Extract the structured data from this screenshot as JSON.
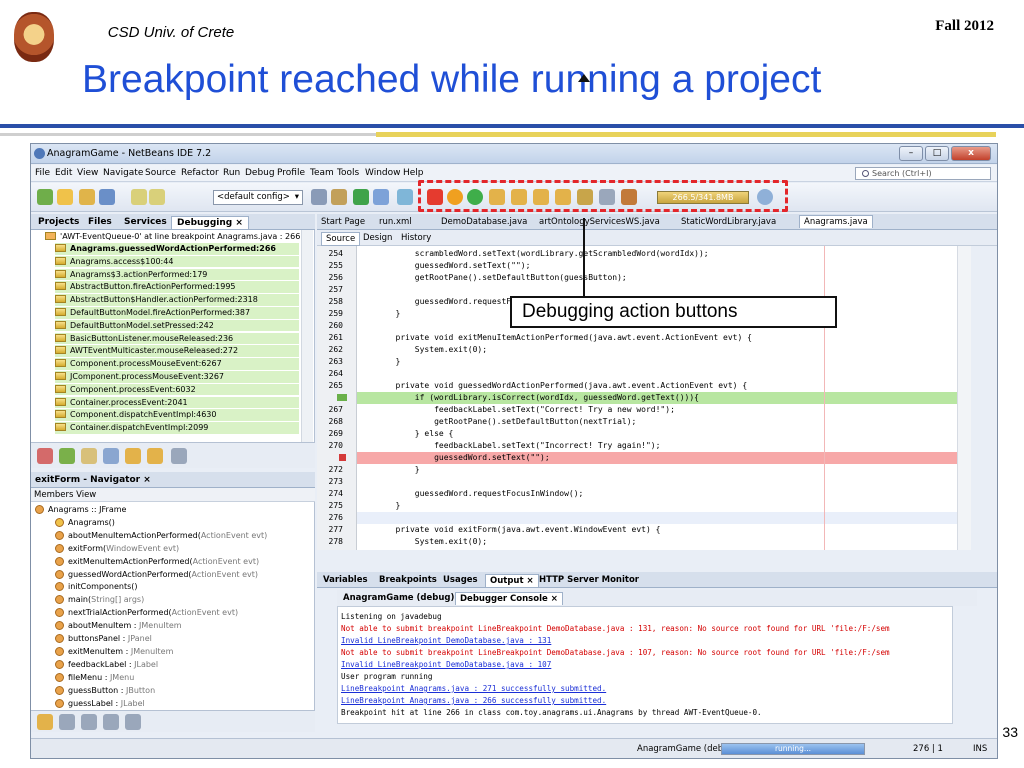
{
  "slide": {
    "course": "CSD Univ. of Crete",
    "semester": "Fall 2012",
    "title": "Breakpoint reached while running a project",
    "page_number": "33",
    "callout": "Debugging action buttons"
  },
  "ide": {
    "window_title": "AnagramGame - NetBeans IDE 7.2",
    "menu": [
      "File",
      "Edit",
      "View",
      "Navigate",
      "Source",
      "Refactor",
      "Run",
      "Debug",
      "Profile",
      "Team",
      "Tools",
      "Window",
      "Help"
    ],
    "search_placeholder": "Search (Ctrl+I)",
    "config": "<default config>",
    "memory": "266.5/341.8MB",
    "project_tabs": [
      "Projects",
      "Files",
      "Services",
      "Debugging ×"
    ],
    "thread": "'AWT-EventQueue-0' at line breakpoint Anagrams.java : 266",
    "call_stack": [
      "Anagrams.guessedWordActionPerformed:266",
      "Anagrams.access$100:44",
      "Anagrams$3.actionPerformed:179",
      "AbstractButton.fireActionPerformed:1995",
      "AbstractButton$Handler.actionPerformed:2318",
      "DefaultButtonModel.fireActionPerformed:387",
      "DefaultButtonModel.setPressed:242",
      "BasicButtonListener.mouseReleased:236",
      "AWTEventMulticaster.mouseReleased:272",
      "Component.processMouseEvent:6267",
      "JComponent.processMouseEvent:3267",
      "Component.processEvent:6032",
      "Container.processEvent:2041",
      "Component.dispatchEventImpl:4630",
      "Container.dispatchEventImpl:2099"
    ],
    "navigator_title": "exitForm - Navigator ×",
    "members_view": "Members View",
    "members": [
      {
        "name": "Anagrams :: JFrame",
        "type": ""
      },
      {
        "name": "Anagrams()",
        "type": ""
      },
      {
        "name": "aboutMenuItemActionPerformed(",
        "type": "ActionEvent evt)"
      },
      {
        "name": "exitForm(",
        "type": "WindowEvent evt)"
      },
      {
        "name": "exitMenuItemActionPerformed(",
        "type": "ActionEvent evt)"
      },
      {
        "name": "guessedWordActionPerformed(",
        "type": "ActionEvent evt)"
      },
      {
        "name": "initComponents()",
        "type": ""
      },
      {
        "name": "main(",
        "type": "String[] args)"
      },
      {
        "name": "nextTrialActionPerformed(",
        "type": "ActionEvent evt)"
      },
      {
        "name": "aboutMenuItem : ",
        "type": "JMenuItem"
      },
      {
        "name": "buttonsPanel : ",
        "type": "JPanel"
      },
      {
        "name": "exitMenuItem : ",
        "type": "JMenuItem"
      },
      {
        "name": "feedbackLabel : ",
        "type": "JLabel"
      },
      {
        "name": "fileMenu : ",
        "type": "JMenu"
      },
      {
        "name": "guessButton : ",
        "type": "JButton"
      },
      {
        "name": "guessLabel : ",
        "type": "JLabel"
      }
    ],
    "editor_tabs": [
      "Start Page",
      "run.xml",
      "DemoDatabase.java",
      "artOntologyServicesWS.java",
      "StaticWordLibrary.java",
      "Anagrams.java"
    ],
    "editor_modes": [
      "Source",
      "Design",
      "History"
    ],
    "code": [
      {
        "n": "254",
        "t": "            scrambledWord.setText(wordLibrary.getScrambledWord(wordIdx));",
        "hl": ""
      },
      {
        "n": "255",
        "t": "            guessedWord.setText(\"\");",
        "hl": ""
      },
      {
        "n": "256",
        "t": "            getRootPane().setDefaultButton(guessButton);",
        "hl": ""
      },
      {
        "n": "257",
        "t": "",
        "hl": ""
      },
      {
        "n": "258",
        "t": "            guessedWord.requestFocusInWindow();",
        "hl": ""
      },
      {
        "n": "259",
        "t": "        }",
        "hl": ""
      },
      {
        "n": "260",
        "t": "",
        "hl": ""
      },
      {
        "n": "261",
        "t": "        private void exitMenuItemActionPerformed(java.awt.event.ActionEvent evt) {",
        "hl": ""
      },
      {
        "n": "262",
        "t": "            System.exit(0);",
        "hl": ""
      },
      {
        "n": "263",
        "t": "        }",
        "hl": ""
      },
      {
        "n": "264",
        "t": "",
        "hl": ""
      },
      {
        "n": "265",
        "t": "        private void guessedWordActionPerformed(java.awt.event.ActionEvent evt) {",
        "hl": ""
      },
      {
        "n": "",
        "t": "            if (wordLibrary.isCorrect(wordIdx, guessedWord.getText())){",
        "hl": "green"
      },
      {
        "n": "267",
        "t": "                feedbackLabel.setText(\"Correct! Try a new word!\");",
        "hl": ""
      },
      {
        "n": "268",
        "t": "                getRootPane().setDefaultButton(nextTrial);",
        "hl": ""
      },
      {
        "n": "269",
        "t": "            } else {",
        "hl": ""
      },
      {
        "n": "270",
        "t": "                feedbackLabel.setText(\"Incorrect! Try again!\");",
        "hl": ""
      },
      {
        "n": "",
        "t": "                guessedWord.setText(\"\");",
        "hl": "red"
      },
      {
        "n": "272",
        "t": "            }",
        "hl": ""
      },
      {
        "n": "273",
        "t": "",
        "hl": ""
      },
      {
        "n": "274",
        "t": "            guessedWord.requestFocusInWindow();",
        "hl": ""
      },
      {
        "n": "275",
        "t": "        }",
        "hl": ""
      },
      {
        "n": "276",
        "t": "",
        "hl": "cur"
      },
      {
        "n": "277",
        "t": "        private void exitForm(java.awt.event.WindowEvent evt) {",
        "hl": ""
      },
      {
        "n": "278",
        "t": "            System.exit(0);",
        "hl": ""
      }
    ],
    "output_tabs": [
      "Variables",
      "Breakpoints",
      "Usages",
      "Output ×",
      "HTTP Server Monitor"
    ],
    "output_subtabs": [
      "AnagramGame (debug) ×",
      "Debugger Console ×"
    ],
    "console": [
      {
        "t": "Listening on javadebug",
        "c": ""
      },
      {
        "t": "Not able to submit breakpoint LineBreakpoint DemoDatabase.java : 131, reason: No source root found for URL 'file:/F:/sem",
        "c": "err"
      },
      {
        "t": "Invalid LineBreakpoint DemoDatabase.java : 131",
        "c": "lnk"
      },
      {
        "t": "Not able to submit breakpoint LineBreakpoint DemoDatabase.java : 107, reason: No source root found for URL 'file:/F:/sem",
        "c": "err"
      },
      {
        "t": "Invalid LineBreakpoint DemoDatabase.java : 107",
        "c": "lnk"
      },
      {
        "t": "User program running",
        "c": ""
      },
      {
        "t": "LineBreakpoint Anagrams.java : 271 successfully submitted.",
        "c": "lnk"
      },
      {
        "t": "LineBreakpoint Anagrams.java : 266 successfully submitted.",
        "c": "lnk"
      },
      {
        "t": "Breakpoint hit at line 266 in class com.toy.anagrams.ui.Anagrams by thread AWT-EventQueue-0.",
        "c": ""
      }
    ],
    "status_process": "AnagramGame (debug)",
    "status_progress": "running...",
    "caret": "276 | 1",
    "insert_mode": "INS"
  }
}
